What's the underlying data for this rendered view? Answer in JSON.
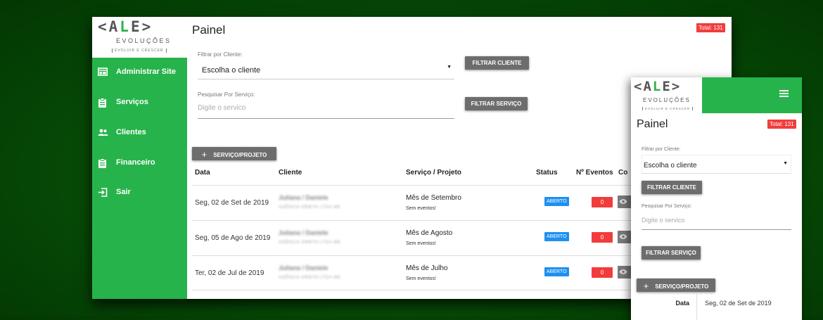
{
  "brand": {
    "logo_main_left": "<A",
    "logo_main_mid": "L",
    "logo_main_right": "E>",
    "logo_sub": "EVOLUÇÕES",
    "logo_tag": "EVOLUIR E CRESCER",
    "accent_color": "#27b34b"
  },
  "sidebar": {
    "items": [
      {
        "label": "Administrar Site",
        "icon": "web-icon"
      },
      {
        "label": "Serviços",
        "icon": "clipboard-icon"
      },
      {
        "label": "Clientes",
        "icon": "people-icon"
      },
      {
        "label": "Financeiro",
        "icon": "clipboard-icon"
      },
      {
        "label": "Sair",
        "icon": "exit-icon"
      }
    ]
  },
  "page": {
    "title": "Painel",
    "total_badge": "Total: 131"
  },
  "filters": {
    "client_label": "Filtrar por Cliente:",
    "client_value": "Escolha o cliente",
    "client_button": "FILTRAR CLIENTE",
    "service_label": "Pesquisar Por Serviço:",
    "service_placeholder": "Digite o servico",
    "service_button": "FILTRAR SERVIÇO"
  },
  "add_button": {
    "plus": "+",
    "label": "SERVIÇO/PROJETO"
  },
  "table": {
    "headers": [
      "Data",
      "Cliente",
      "Serviço / Projeto",
      "Status",
      "Nº Eventos",
      "Co"
    ],
    "rows": [
      {
        "date": "Seg, 02 de Set de 2019",
        "client": "Juliana / Daniele",
        "client_sub": "AGÊNCIA ORBITA LTDA-ME",
        "service": "Mês de Setembro",
        "service_sub": "Sem eventos!",
        "status": "ABERTO",
        "events": "0"
      },
      {
        "date": "Seg, 05 de Ago de 2019",
        "client": "Juliana / Daniele",
        "client_sub": "AGÊNCIA ORBITA LTDA-ME",
        "service": "Mês de Agosto",
        "service_sub": "Sem eventos!",
        "status": "ABERTO",
        "events": "0"
      },
      {
        "date": "Ter, 02 de Jul de 2019",
        "client": "Juliana / Daniele",
        "client_sub": "AGÊNCIA ORBITA LTDA-ME",
        "service": "Mês de Julho",
        "service_sub": "Sem eventos!",
        "status": "ABERTO",
        "events": "0"
      }
    ]
  },
  "mobile": {
    "title": "Painel",
    "total_badge": "Total: 131",
    "date_label": "Data",
    "date_value": "Seg, 02 de Set de 2019"
  }
}
